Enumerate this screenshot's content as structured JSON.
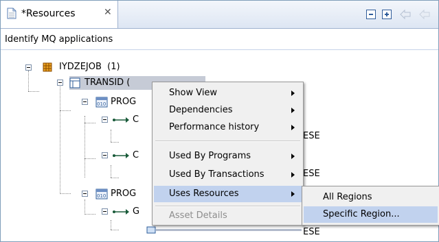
{
  "tab": {
    "title": "*Resources",
    "close": "✕"
  },
  "view": {
    "subtitle": "Identify MQ applications"
  },
  "tree": {
    "root": "IYDZEJOB  (1)",
    "transid": "TRANSID (",
    "prog1": "PROG",
    "prog2": "PROG",
    "c1": "C",
    "c2": "C",
    "g1": "G",
    "ese1": "ESE",
    "ese2": "ESE",
    "ese3": "ESE"
  },
  "context_menu": {
    "items": [
      {
        "label": "Show View"
      },
      {
        "label": "Dependencies"
      },
      {
        "label": "Performance history"
      },
      {
        "label": "Used By Programs"
      },
      {
        "label": "Used By Transactions"
      },
      {
        "label": "Uses Resources"
      },
      {
        "label": "Asset Details"
      }
    ]
  },
  "submenu": {
    "items": [
      {
        "label": "All Regions"
      },
      {
        "label": "Specific Region..."
      }
    ]
  },
  "colors": {
    "highlight": "#c1d2ee",
    "disabled": "#8d8d8d"
  }
}
